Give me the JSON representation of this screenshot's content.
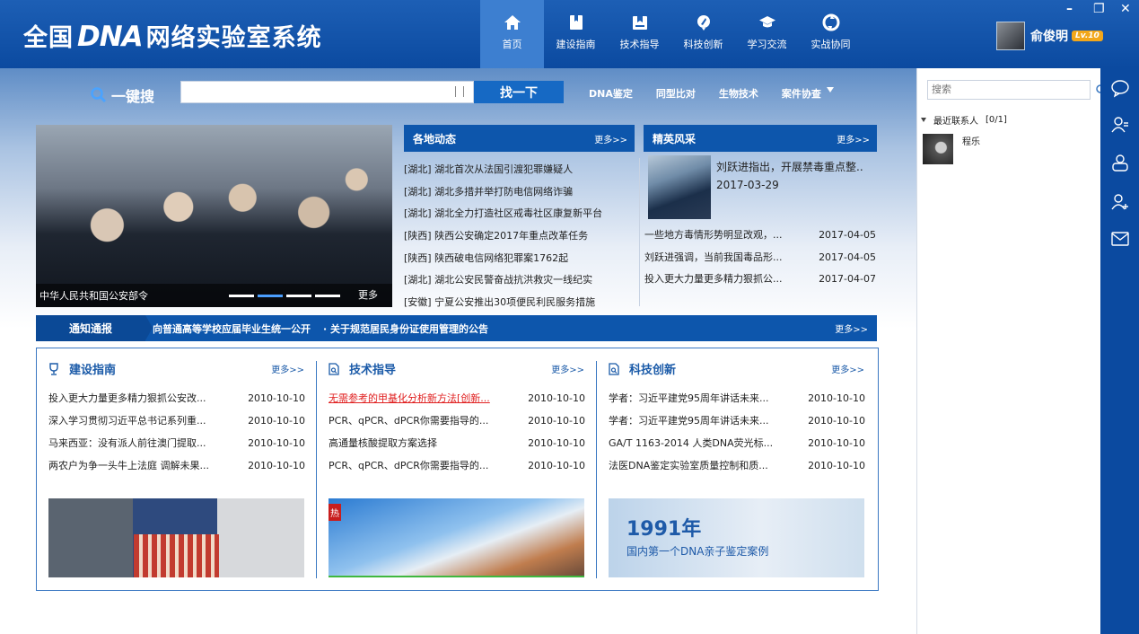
{
  "header": {
    "logo_prefix": "全国",
    "logo_mark": "DNA",
    "logo_suffix": "网络实验室系统",
    "nav": [
      {
        "label": "首页",
        "icon": "home-icon",
        "active": true
      },
      {
        "label": "建设指南",
        "icon": "bookmark-icon"
      },
      {
        "label": "技术指导",
        "icon": "image-bookmark-icon"
      },
      {
        "label": "科技创新",
        "icon": "rocket-icon"
      },
      {
        "label": "学习交流",
        "icon": "graduation-cap-icon"
      },
      {
        "label": "实战协同",
        "icon": "recycle-icon"
      }
    ],
    "user": {
      "name": "俞俊明",
      "level": "Lv.10"
    },
    "window": {
      "minimize": "–",
      "restore": "❐",
      "close": "✕"
    }
  },
  "search": {
    "label": "一键搜",
    "placeholder": "",
    "button": "找一下",
    "quick_links": [
      "DNA鉴定",
      "同型比对",
      "生物技术",
      "案件协查"
    ]
  },
  "banner": {
    "caption": "中华人民共和国公安部令",
    "more": "更多",
    "dots": 4,
    "active_dot": 1
  },
  "regional_news": {
    "title": "各地动态",
    "more": "更多>>",
    "items": [
      "[湖北] 湖北首次从法国引渡犯罪嫌疑人",
      "[湖北] 湖北多措并举打防电信网络诈骗",
      "[湖北] 湖北全力打造社区戒毒社区康复新平台",
      "[陕西] 陕西公安确定2017年重点改革任务",
      "[陕西] 陕西破电信网络犯罪案1762起",
      "[湖北] 湖北公安民警奋战抗洪救灾一线纪实",
      "[安徽] 宁夏公安推出30项便民利民服务措施"
    ]
  },
  "elite": {
    "title": "精英风采",
    "more": "更多>>",
    "featured_title": "刘跃进指出，开展禁毒重点整..",
    "featured_date": "2017-03-29",
    "items": [
      {
        "title": "一些地方毒情形势明显改观，...",
        "date": "2017-04-05"
      },
      {
        "title": "刘跃进强调，当前我国毒品形...",
        "date": "2017-04-05"
      },
      {
        "title": "投入更大力量更多精力狠抓公...",
        "date": "2017-04-07"
      }
    ]
  },
  "notice": {
    "label": "通知通报",
    "items": [
      "向普通高等学校应届毕业生统一公开",
      "· 关于规范居民身份证使用管理的公告"
    ],
    "more": "更多>>"
  },
  "columns": [
    {
      "title": "建设指南",
      "icon": "trophy-icon",
      "more": "更多>>",
      "rows": [
        {
          "title": "投入更大力量更多精力狠抓公安改...",
          "date": "2010-10-10"
        },
        {
          "title": "深入学习贯彻习近平总书记系列重...",
          "date": "2010-10-10"
        },
        {
          "title": "马来西亚：没有派人前往澳门提取...",
          "date": "2010-10-10"
        },
        {
          "title": "两农户为争一头牛上法庭 调解未果...",
          "date": "2010-10-10"
        }
      ]
    },
    {
      "title": "技术指导",
      "icon": "document-search-icon",
      "more": "更多>>",
      "rows": [
        {
          "title": "无需参考的甲基化分析新方法[创新...",
          "date": "2010-10-10",
          "highlight": true
        },
        {
          "title": "PCR、qPCR、dPCR你需要指导的...",
          "date": "2010-10-10"
        },
        {
          "title": "高通量核酸提取方案选择",
          "date": "2010-10-10"
        },
        {
          "title": "PCR、qPCR、dPCR你需要指导的...",
          "date": "2010-10-10"
        }
      ],
      "image_tag": "热"
    },
    {
      "title": "科技创新",
      "icon": "document-search-icon",
      "more": "更多>>",
      "rows": [
        {
          "title": "学者：习近平建党95周年讲话未来...",
          "date": "2010-10-10"
        },
        {
          "title": "学者：习近平建党95周年讲话未来...",
          "date": "2010-10-10"
        },
        {
          "title": "GA/T 1163-2014 人类DNA荧光标...",
          "date": "2010-10-10"
        },
        {
          "title": "法医DNA鉴定实验室质量控制和质...",
          "date": "2010-10-10"
        }
      ],
      "image_year": "1991年",
      "image_caption": "国内第一个DNA亲子鉴定案例"
    }
  ],
  "contacts": {
    "search_placeholder": "搜索",
    "group_label": "最近联系人",
    "group_count": "[0/1]",
    "items": [
      {
        "name": "程乐"
      }
    ]
  },
  "side_strip": [
    "chat-bubble-icon",
    "contact-list-icon",
    "group-icon",
    "add-contact-icon",
    "mail-icon"
  ],
  "colors": {
    "brand": "#0d56ac",
    "header": "#1d5fb5",
    "active_nav": "#3d7fd0",
    "highlight": "#e02020"
  }
}
